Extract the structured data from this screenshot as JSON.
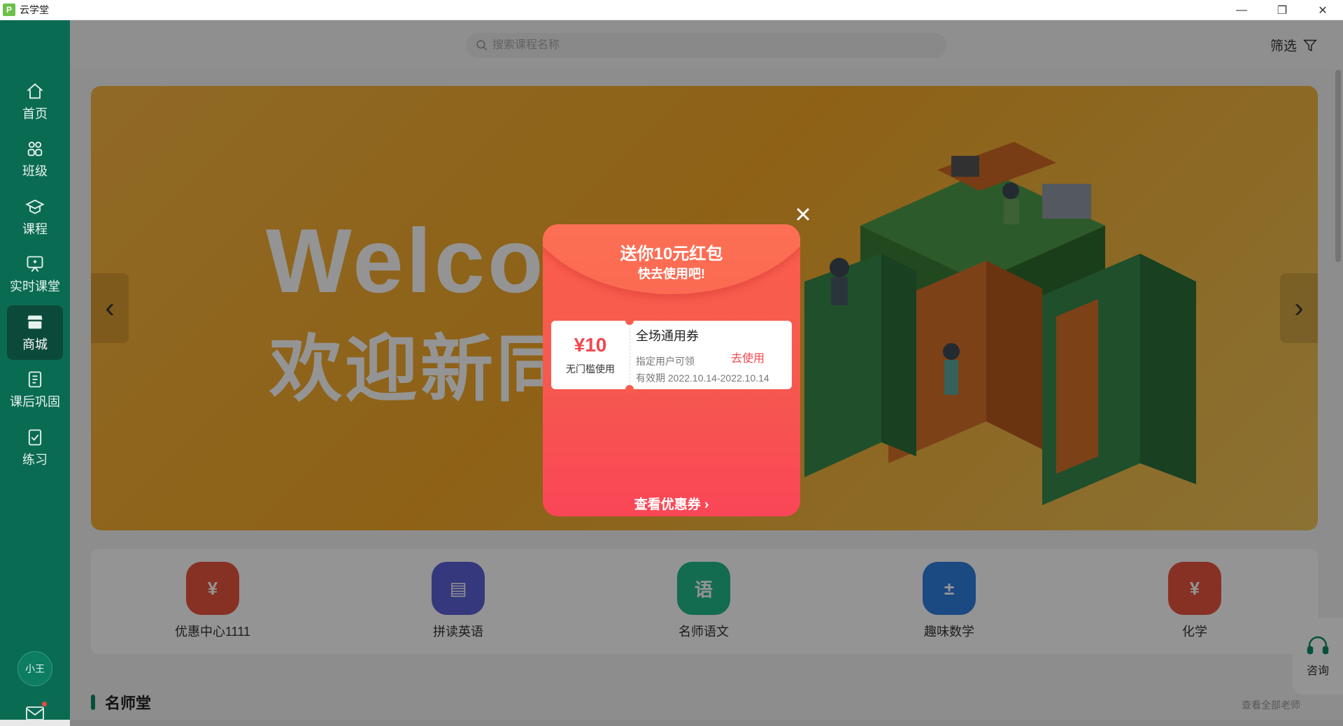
{
  "window": {
    "logo_text": "P",
    "title": "云学堂",
    "controls": {
      "minimize": "—",
      "maximize": "❐",
      "close": "✕"
    }
  },
  "sidebar": {
    "items": [
      {
        "label": "首页",
        "icon": "home-icon"
      },
      {
        "label": "班级",
        "icon": "class-icon"
      },
      {
        "label": "课程",
        "icon": "course-icon"
      },
      {
        "label": "实时课堂",
        "icon": "live-class-icon"
      },
      {
        "label": "商城",
        "icon": "store-icon",
        "active": true
      },
      {
        "label": "课后巩固",
        "icon": "review-icon"
      },
      {
        "label": "练习",
        "icon": "practice-icon"
      }
    ],
    "avatar_text": "小王",
    "has_unread_mail": true
  },
  "header": {
    "search_placeholder": "搜索课程名称",
    "filter_label": "筛选"
  },
  "banner": {
    "headline": "Welco",
    "subheadline": "欢迎新同",
    "prev_arrow": "‹",
    "next_arrow": "›"
  },
  "categories": [
    {
      "label": "优惠中心1111",
      "icon": "coupon-ticket-icon",
      "color": "#e9553f",
      "glyph": "¥"
    },
    {
      "label": "拼读英语",
      "icon": "book-icon",
      "color": "#5c61d6",
      "glyph": "▤"
    },
    {
      "label": "名师语文",
      "icon": "chinese-icon",
      "color": "#22b88a",
      "glyph": "语"
    },
    {
      "label": "趣味数学",
      "icon": "math-icon",
      "color": "#2f7fe0",
      "glyph": "±"
    },
    {
      "label": "化学",
      "icon": "coupon-ticket-icon",
      "color": "#e9553f",
      "glyph": "¥"
    }
  ],
  "section": {
    "title": "名师堂",
    "see_all": "查看全部老师"
  },
  "consult_label": "咨询",
  "dialog": {
    "close": "×",
    "title": "送你10元红包",
    "subtitle": "快去使用吧!",
    "coupon": {
      "amount": "¥10",
      "condition": "无门槛使用",
      "name": "全场通用券",
      "scope": "指定用户可领",
      "expiry": "有效期 2022.10.14-2022.10.14",
      "action": "去使用"
    },
    "link": "查看优惠券 ›"
  },
  "colors": {
    "sidebar": "#0a6b53",
    "sidebar_active": "#0b4a3a",
    "accent_red": "#f2474f",
    "banner": "#f4a827"
  }
}
